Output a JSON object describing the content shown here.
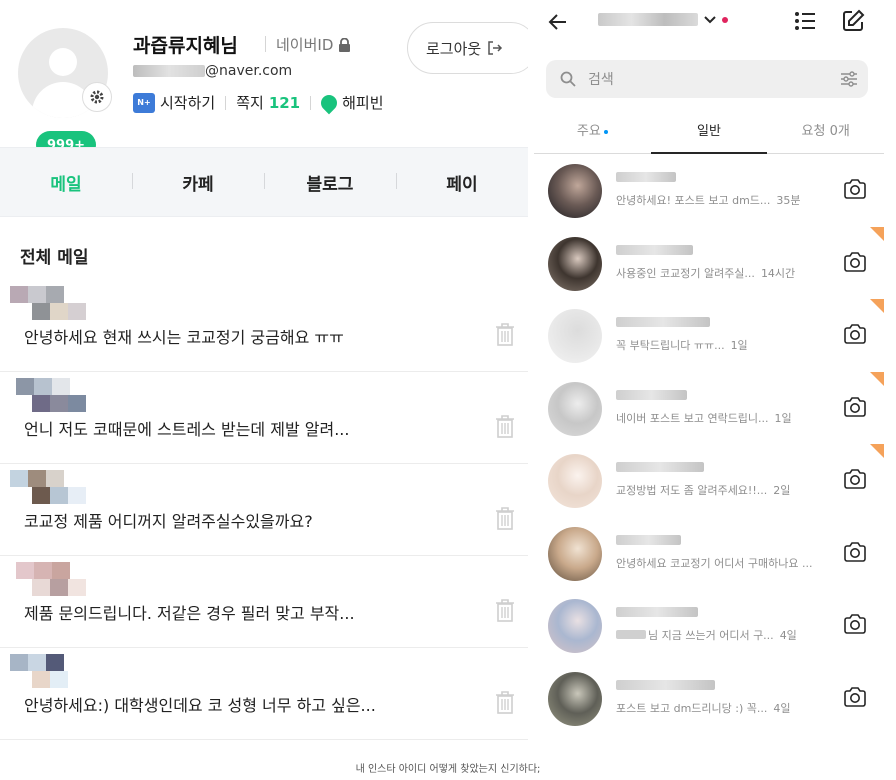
{
  "naver": {
    "profile": {
      "username": "과즙류지혜님",
      "naver_id_label": "네이버ID",
      "email_suffix": "@naver.com",
      "notification_badge": "999+",
      "logout_label": "로그아웃"
    },
    "links": {
      "start_label": "시작하기",
      "start_icon_text": "N+",
      "notes_label": "쪽지",
      "notes_count": "121",
      "happybean_label": "해피빈"
    },
    "tabs": [
      "메일",
      "카페",
      "블로그",
      "페이"
    ],
    "section_title": "전체 메일",
    "mails": [
      {
        "subject": "안녕하세요 현재 쓰시는 코교정기 궁금해요 ㅠㅠ",
        "pixels": [
          "#b9a9b4",
          "#c9c9cf",
          "#a7aab0",
          "#8f9296",
          "#e0d6c8",
          "#d5cfd2"
        ]
      },
      {
        "subject": "언니 저도 코때문에 스트레스 받는데 제발 알려...",
        "pixels": [
          "#8c96a6",
          "#b7c2cf",
          "#e3e6ea",
          "#6f6b87",
          "#8a8a9c",
          "#7c8aa0"
        ]
      },
      {
        "subject": "코교정 제품 어디꺼지 알려주실수있을까요?",
        "pixels": [
          "#c3d3e0",
          "#9e8c7d",
          "#d8d2cb",
          "#6d5a4e",
          "#b7c6d4",
          "#e7eef6"
        ]
      },
      {
        "subject": "제품 문의드립니다. 저같은 경우 필러 맞고 부작...",
        "pixels": [
          "#e3c7cb",
          "#d6b4b3",
          "#c9a59f",
          "#e8d9d6",
          "#b79fa0",
          "#f1e4e0"
        ]
      },
      {
        "subject": "안녕하세요:) 대학생인데요 코 성형 너무 하고 싶은...",
        "pixels": [
          "#a7b5c6",
          "#c9d6e3",
          "#545a78",
          "#e8d6c9",
          "#e3eef6",
          "#ffffff"
        ]
      }
    ]
  },
  "instagram": {
    "search_placeholder": "검색",
    "tabs": [
      {
        "label": "주요",
        "dot": true
      },
      {
        "label": "일반",
        "dot": false
      },
      {
        "label": "요청 0개",
        "dot": false
      }
    ],
    "messages": [
      {
        "preview": "안녕하세요! 포스트 보고 dm드...",
        "time": "35분",
        "unread_corner": false,
        "avatar_colors": [
          "#1a1a1f",
          "#6a5a55",
          "#c0a79a"
        ]
      },
      {
        "preview": "사용중인 코교정기 알려주실...",
        "time": "14시간",
        "unread_corner": true,
        "avatar_colors": [
          "#8a7d73",
          "#3e352f",
          "#d9c9bf"
        ]
      },
      {
        "preview": "꼭 부탁드립니다 ㅠㅠ...",
        "time": "1일",
        "unread_corner": true,
        "avatar_colors": [
          "#f4f4f4",
          "#e6e6e6",
          "#dcdcdc"
        ]
      },
      {
        "preview": "네이버 포스트 보고 연락드립니...",
        "time": "1일",
        "unread_corner": true,
        "avatar_colors": [
          "#dcdcdc",
          "#c7c7c7",
          "#ededed"
        ]
      },
      {
        "preview": "교정방법 저도 좀 알려주세요!!...",
        "time": "2일",
        "unread_corner": true,
        "avatar_colors": [
          "#f4e6dc",
          "#e8d5c8",
          "#fbf3ee"
        ]
      },
      {
        "preview": "안녕하세요 코교정기 어디서 구매하나요 ...",
        "time": "",
        "unread_corner": false,
        "avatar_colors": [
          "#5a4a3a",
          "#c9a98b",
          "#f0e2d2"
        ]
      },
      {
        "preview": "님 지금 쓰는거 어디서 구...",
        "time": "4일",
        "unread_corner": false,
        "avatar_colors": [
          "#d9c4c7",
          "#aab7d0",
          "#e9e0e3"
        ]
      },
      {
        "preview": "포스트 보고 dm드리니당 :) 꼭...",
        "time": "4일",
        "unread_corner": false,
        "avatar_colors": [
          "#9a9a86",
          "#5f5f57",
          "#c9c7ba"
        ]
      }
    ]
  },
  "caption": "내 인스타 아이디 어떻게 찾았는지 신기하다;",
  "colors": {
    "naver_green": "#19c37d",
    "ig_corner": "#f5a25a",
    "ig_dot": "#0095f6",
    "ig_red_dot": "#e0245e"
  }
}
